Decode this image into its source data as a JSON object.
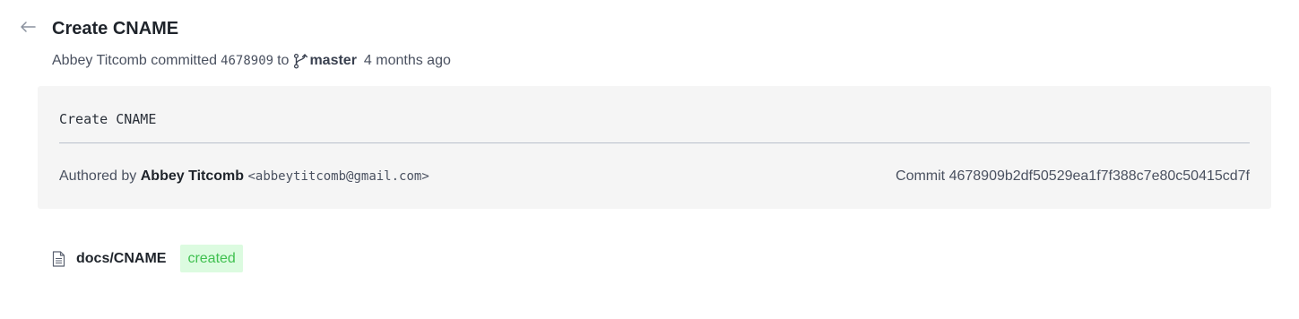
{
  "commit": {
    "title": "Create CNAME",
    "author": "Abbey Titcomb",
    "action": "committed",
    "short_hash": "4678909",
    "to_text": "to",
    "branch": "master",
    "time_ago": "4 months ago",
    "message": "Create CNAME",
    "authored_by_label": "Authored by",
    "author_email": "<abbeytitcomb@gmail.com>",
    "full_hash_text": "Commit 4678909b2df50529ea1f7f388c7e80c50415cd7f"
  },
  "files": [
    {
      "path": "docs/CNAME",
      "status": "created"
    }
  ],
  "icons": {
    "back": "arrow-left-icon",
    "branch": "git-branch-icon",
    "file": "file-text-icon"
  },
  "colors": {
    "created_badge_bg": "#dcfbe0",
    "created_badge_text": "#3fc04f",
    "box_bg": "#f5f5f5"
  }
}
